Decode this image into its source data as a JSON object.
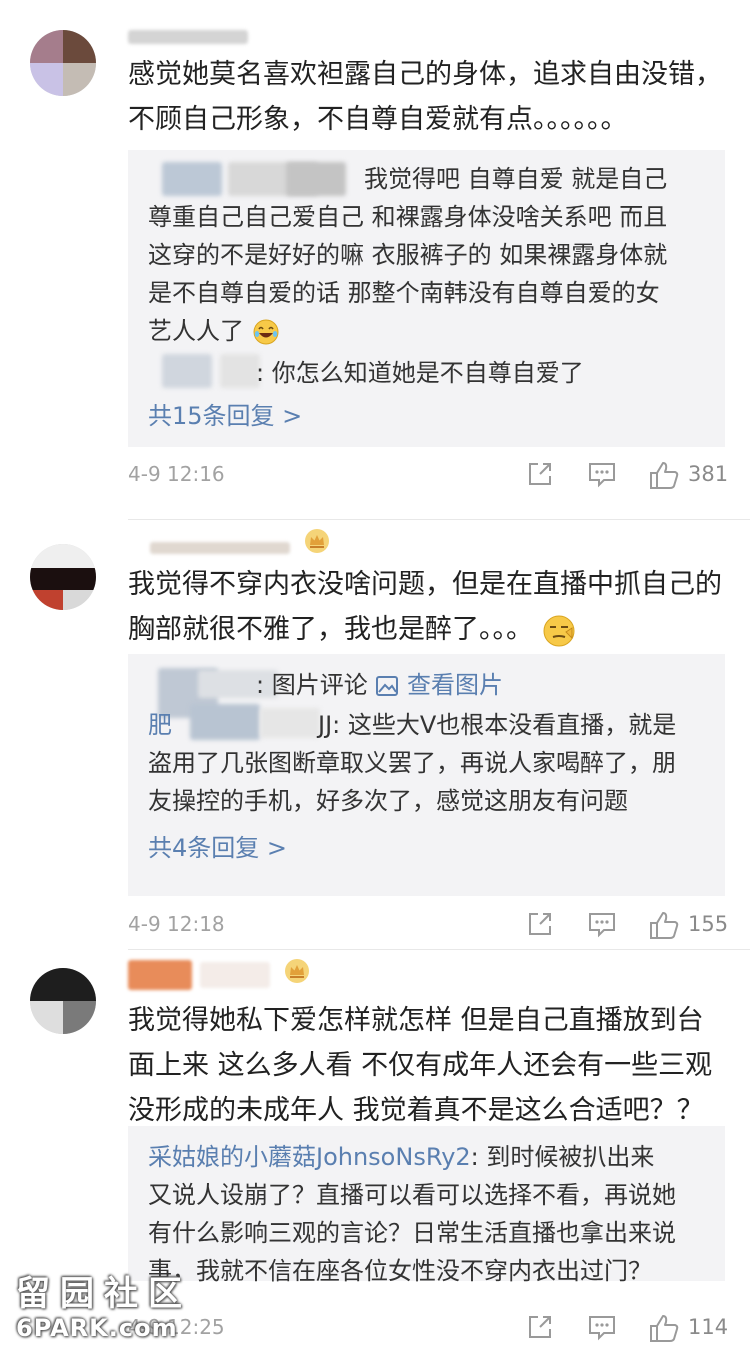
{
  "colors": {
    "link": "#5a7fb0",
    "meta": "#a2a2a2",
    "reply_bg": "#f3f3f5",
    "crown": "#e2a13a"
  },
  "comments": [
    {
      "body": [
        "感觉她莫名喜欢袒露自己的身体，追求自由没错，",
        "不顾自己形象，不自尊自爱就有点。。。。。。"
      ],
      "replies_line1_text": "我觉得吧 自尊自爱 就是自己",
      "replies_lines": [
        "尊重自己自己爱自己 和裸露身体没啥关系吧 而且",
        "这穿的不是好好的嘛 衣服裤子的 如果裸露身体就",
        "是不自尊自爱的话 那整个南韩没有自尊自爱的女"
      ],
      "replies_last_text": "艺人人了",
      "reply2_text": ": 你怎么知道她是不自尊自爱了",
      "more_label": "共15条回复 >",
      "time": "4-9 12:16",
      "likes": "381"
    },
    {
      "body": [
        "我觉得不穿内衣没啥问题，但是在直播中抓自己的",
        "胸部就很不雅了，我也是醉了。。。"
      ],
      "reply1_text": ": 图片评论",
      "reply1_link": "查看图片",
      "reply2_prefix": "肥",
      "reply2_suffix": "JJ: 这些大V也根本没看直播，就是",
      "reply2_lines": [
        "盗用了几张图断章取义罢了，再说人家喝醉了，朋",
        "友操控的手机，好多次了，感觉这朋友有问题"
      ],
      "more_label": "共4条回复 >",
      "time": "4-9 12:18",
      "likes": "155"
    },
    {
      "body": [
        "我觉得她私下爱怎样就怎样 但是自己直播放到台",
        "面上来 这么多人看 不仅有成年人还会有一些三观",
        "没形成的未成年人 我觉着真不是这么合适吧？？"
      ],
      "reply_name": "采姑娘的小蘑菇JohnsoNsRy2",
      "reply_first": ": 到时候被扒出来",
      "reply_lines": [
        "又说人设崩了？直播可以看可以选择不看，再说她",
        "有什么影响三观的言论？日常生活直播也拿出来说",
        "事，我就不信在座各位女性没不穿内衣出过门？"
      ],
      "time": "4-9 12:25",
      "likes": "114"
    }
  ],
  "watermark": {
    "title": "留园社区",
    "sub": "6PARK.com"
  },
  "icons": {
    "share": "share-icon",
    "comment": "comment-icon",
    "like": "thumbs-up-icon",
    "crown": "crown-badge-icon",
    "laugh": "laughing-emoji-icon",
    "smirk": "smirk-emoji-icon",
    "picture": "picture-icon"
  }
}
